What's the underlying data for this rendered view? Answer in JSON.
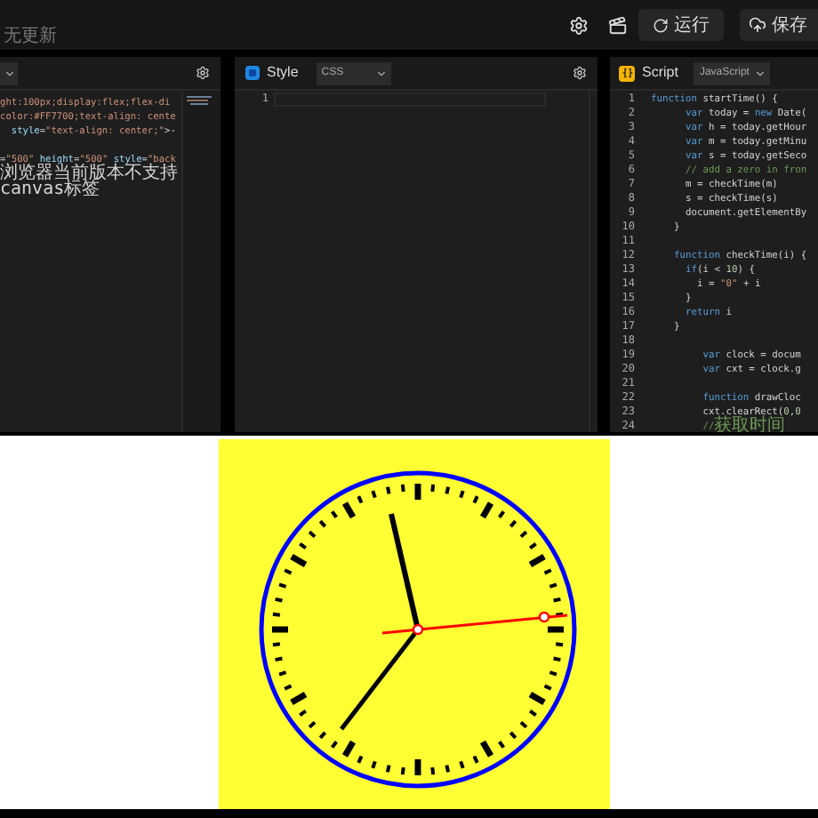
{
  "topbar": {
    "status": "无更新",
    "run_button": "运行",
    "save_button": "保存"
  },
  "html_panel": {
    "lines": [
      {
        "tokens": [
          {
            "kind": "string",
            "text": "ght:100px;display:flex;flex-di"
          }
        ]
      },
      {
        "tokens": [
          {
            "kind": "string",
            "text": "color:#FF7700;text-align: cente"
          }
        ]
      },
      {
        "tokens": [
          {
            "kind": "attr",
            "text": "  style"
          },
          {
            "kind": "plain",
            "text": "="
          },
          {
            "kind": "string",
            "text": "\"text-align: center;\""
          },
          {
            "kind": "plain",
            "text": ">-"
          }
        ]
      },
      {
        "blank": true
      },
      {
        "tokens": [
          {
            "kind": "plain",
            "text": "="
          },
          {
            "kind": "string",
            "text": "\"500\""
          },
          {
            "kind": "attr",
            "text": " height"
          },
          {
            "kind": "plain",
            "text": "="
          },
          {
            "kind": "string",
            "text": "\"500\""
          },
          {
            "kind": "attr",
            "text": " style"
          },
          {
            "kind": "plain",
            "text": "="
          },
          {
            "kind": "string",
            "text": "\"back"
          }
        ]
      },
      {
        "tokens": [
          {
            "kind": "plain",
            "text": "浏览器当前版本不支持canvas标签"
          }
        ]
      }
    ]
  },
  "css_panel": {
    "title": "Style",
    "language": "CSS",
    "line_numbers": [
      "1"
    ]
  },
  "js_panel": {
    "title": "Script",
    "language": "JavaScript",
    "lines": [
      {
        "num": "1",
        "tokens": [
          {
            "kind": "keyword",
            "text": "function"
          },
          {
            "kind": "plain",
            "text": " startTime() {"
          }
        ]
      },
      {
        "num": "2",
        "tokens": [
          {
            "kind": "keyword",
            "text": "      var"
          },
          {
            "kind": "plain",
            "text": " today = "
          },
          {
            "kind": "keyword",
            "text": "new"
          },
          {
            "kind": "plain",
            "text": " Date("
          }
        ]
      },
      {
        "num": "3",
        "tokens": [
          {
            "kind": "keyword",
            "text": "      var"
          },
          {
            "kind": "plain",
            "text": " h = today.getHour"
          }
        ]
      },
      {
        "num": "4",
        "tokens": [
          {
            "kind": "keyword",
            "text": "      var"
          },
          {
            "kind": "plain",
            "text": " m = today.getMinu"
          }
        ]
      },
      {
        "num": "5",
        "tokens": [
          {
            "kind": "keyword",
            "text": "      var"
          },
          {
            "kind": "plain",
            "text": " s = today.getSeco"
          }
        ]
      },
      {
        "num": "6",
        "tokens": [
          {
            "kind": "comment",
            "text": "      // add a zero in fron"
          }
        ]
      },
      {
        "num": "7",
        "tokens": [
          {
            "kind": "plain",
            "text": "      m = checkTime(m)"
          }
        ]
      },
      {
        "num": "8",
        "tokens": [
          {
            "kind": "plain",
            "text": "      s = checkTime(s)"
          }
        ]
      },
      {
        "num": "9",
        "tokens": [
          {
            "kind": "plain",
            "text": "      document.getElementBy"
          }
        ]
      },
      {
        "num": "10",
        "tokens": [
          {
            "kind": "plain",
            "text": "    }"
          }
        ]
      },
      {
        "num": "11"
      },
      {
        "num": "12",
        "tokens": [
          {
            "kind": "keyword",
            "text": "    function"
          },
          {
            "kind": "plain",
            "text": " checkTime(i) {"
          }
        ]
      },
      {
        "num": "13",
        "tokens": [
          {
            "kind": "keyword",
            "text": "      if"
          },
          {
            "kind": "plain",
            "text": "(i < "
          },
          {
            "kind": "number",
            "text": "10"
          },
          {
            "kind": "plain",
            "text": ") {"
          }
        ]
      },
      {
        "num": "14",
        "tokens": [
          {
            "kind": "plain",
            "text": "        i = "
          },
          {
            "kind": "string",
            "text": "\"0\""
          },
          {
            "kind": "plain",
            "text": " + i"
          }
        ]
      },
      {
        "num": "15",
        "tokens": [
          {
            "kind": "plain",
            "text": "      }"
          }
        ]
      },
      {
        "num": "16",
        "tokens": [
          {
            "kind": "keyword",
            "text": "      return"
          },
          {
            "kind": "plain",
            "text": " i"
          }
        ]
      },
      {
        "num": "17",
        "tokens": [
          {
            "kind": "plain",
            "text": "    }"
          }
        ]
      },
      {
        "num": "18"
      },
      {
        "num": "19",
        "tokens": [
          {
            "kind": "keyword",
            "text": "         var"
          },
          {
            "kind": "plain",
            "text": " clock = docum"
          }
        ]
      },
      {
        "num": "20",
        "tokens": [
          {
            "kind": "keyword",
            "text": "         var"
          },
          {
            "kind": "plain",
            "text": " cxt = clock.g"
          }
        ]
      },
      {
        "num": "21"
      },
      {
        "num": "22",
        "tokens": [
          {
            "kind": "keyword",
            "text": "         function"
          },
          {
            "kind": "plain",
            "text": " drawCloc"
          }
        ]
      },
      {
        "num": "23",
        "tokens": [
          {
            "kind": "plain",
            "text": "         cxt.clearRect("
          },
          {
            "kind": "number",
            "text": "0"
          },
          {
            "kind": "plain",
            "text": ","
          },
          {
            "kind": "number",
            "text": "0"
          }
        ]
      },
      {
        "num": "24",
        "tokens": [
          {
            "kind": "comment",
            "text": "         //"
          },
          {
            "kind": "comment",
            "text": "获取时间"
          }
        ]
      }
    ]
  }
}
